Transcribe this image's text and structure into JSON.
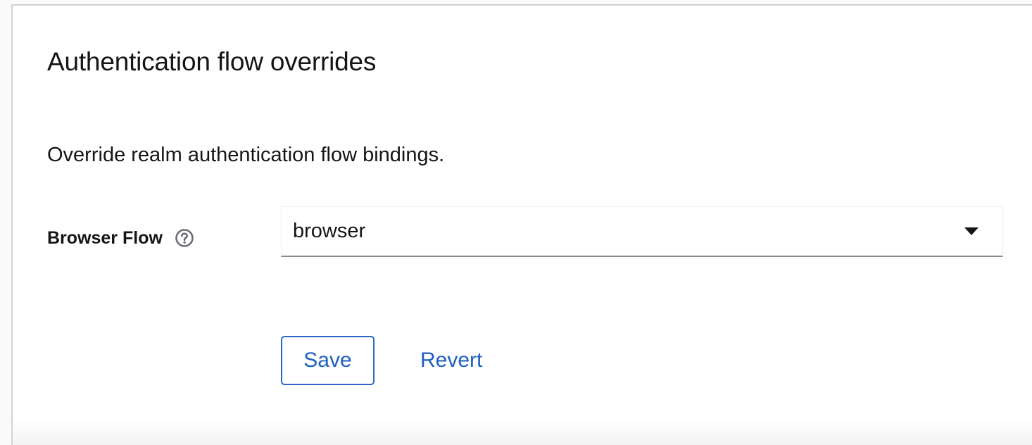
{
  "section": {
    "title": "Authentication flow overrides",
    "description": "Override realm authentication flow bindings."
  },
  "form": {
    "browser_flow": {
      "label": "Browser Flow",
      "help_icon": "question-circle-icon",
      "selected_value": "browser",
      "caret_icon": "caret-down-icon"
    }
  },
  "actions": {
    "save_label": "Save",
    "revert_label": "Revert"
  },
  "colors": {
    "link_blue": "#1f5fbf",
    "primary_border": "#2b66c6",
    "text": "#151515",
    "input_underline": "#8a8d90"
  }
}
